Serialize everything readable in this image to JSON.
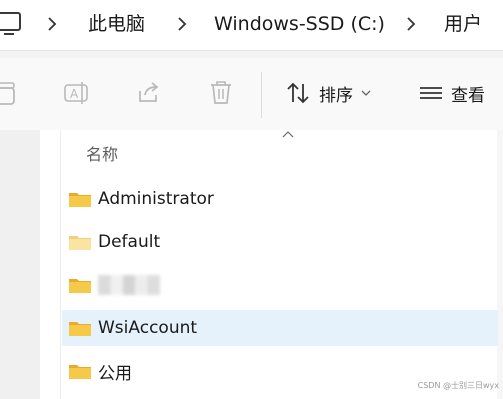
{
  "address": {
    "crumbs": [
      "此电脑",
      "Windows-SSD (C:)",
      "用户"
    ]
  },
  "toolbar": {
    "sort_label": "排序",
    "view_label": "查看"
  },
  "list": {
    "column_name": "名称",
    "rows": [
      {
        "name": "Administrator",
        "selected": false
      },
      {
        "name": "Default",
        "selected": false
      },
      {
        "name": "",
        "redacted": true,
        "selected": false
      },
      {
        "name": "WsiAccount",
        "selected": true
      },
      {
        "name": "公用",
        "selected": false
      }
    ]
  },
  "watermark": "CSDN @士别三日wyx",
  "icons": {
    "monitor": "monitor-icon",
    "copy": "copy-icon",
    "rename": "rename-icon",
    "share": "share-icon",
    "delete": "delete-icon",
    "sort": "sort-arrows-icon",
    "view": "view-lines-icon",
    "folder": "folder-icon"
  },
  "colors": {
    "folder_body": "#f7c948",
    "folder_tab": "#e8ab2c",
    "folder_default_body": "#fbe3a1",
    "selected_row": "#e5f1fb"
  }
}
